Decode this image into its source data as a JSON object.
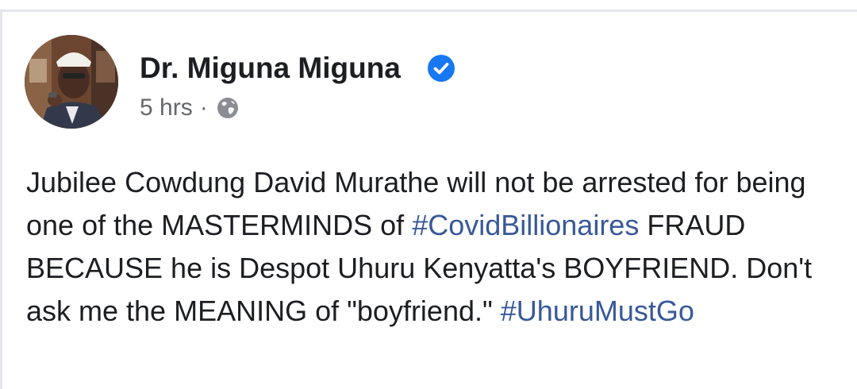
{
  "post": {
    "author_name": "Dr. Miguna Miguna",
    "verified_icon": "verified-badge-icon",
    "timestamp": "5 hrs",
    "separator": "·",
    "privacy_icon": "globe-icon",
    "body": {
      "text_1": "Jubilee Cowdung David Murathe will not be arrested for being one of the MASTERMINDS of ",
      "hashtag_1": "#CovidBillionaires",
      "text_2": " FRAUD BECAUSE he is Despot Uhuru Kenyatta's BOYFRIEND. Don't ask me the MEANING of \"boyfriend.\" ",
      "hashtag_2": "#UhuruMustGo"
    }
  },
  "colors": {
    "name_text": "#1c1e21",
    "meta_text": "#65676b",
    "hashtag": "#385898",
    "verified_badge": "#1877f2",
    "divider": "#e4e6eb"
  }
}
